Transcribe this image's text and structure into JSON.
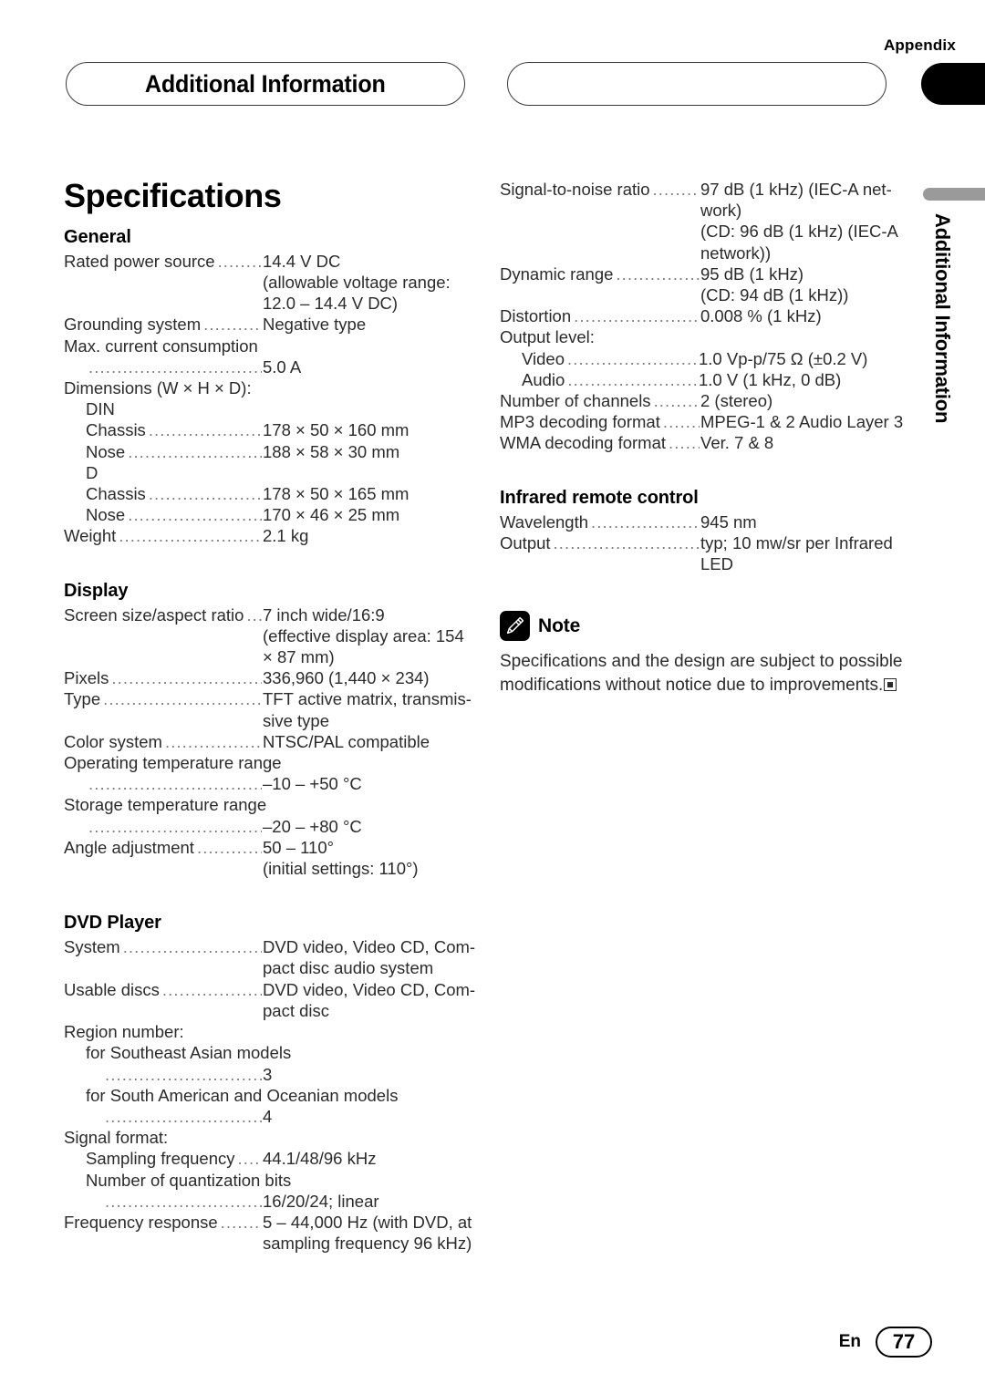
{
  "header": {
    "appendix_label": "Appendix",
    "chapter_title": "Additional Information",
    "empty_pill": ""
  },
  "side_tab": {
    "label": "Additional Information"
  },
  "page_title": "Specifications",
  "footer": {
    "language": "En",
    "page_number": "77"
  },
  "leader": "..................................................................................................",
  "sections": {
    "general": {
      "heading": "General",
      "rows": [
        {
          "label": "Rated power source",
          "value": "14.4 V DC"
        },
        {
          "cont": "(allowable voltage range:"
        },
        {
          "cont": "12.0 – 14.4 V DC)"
        },
        {
          "label": "Grounding system",
          "value": "Negative type"
        },
        {
          "line": "Max. current consumption"
        },
        {
          "label": "",
          "value": "5.0 A",
          "indent": 1
        },
        {
          "line": "Dimensions (W × H × D):"
        },
        {
          "line": "DIN",
          "indent": 1
        },
        {
          "label": "Chassis",
          "value": "178 × 50 × 160 mm",
          "indent": 1
        },
        {
          "label": "Nose",
          "value": "188 × 58 × 30 mm",
          "indent": 1
        },
        {
          "line": "D",
          "indent": 1
        },
        {
          "label": "Chassis",
          "value": "178 × 50 × 165 mm",
          "indent": 1
        },
        {
          "label": "Nose",
          "value": "170 × 46 × 25 mm",
          "indent": 1
        },
        {
          "label": "Weight",
          "value": "2.1 kg"
        }
      ]
    },
    "display": {
      "heading": "Display",
      "rows": [
        {
          "label": "Screen size/aspect ratio",
          "value": "7 inch wide/16:9"
        },
        {
          "cont": "(effective display area: 154"
        },
        {
          "cont": "× 87 mm)"
        },
        {
          "label": "Pixels",
          "value": "336,960 (1,440 × 234)"
        },
        {
          "label": "Type",
          "value": "TFT active matrix, transmis-"
        },
        {
          "cont": "sive type"
        },
        {
          "label": "Color system",
          "value": "NTSC/PAL compatible"
        },
        {
          "line": "Operating temperature range"
        },
        {
          "label": "",
          "value": "–10 – +50 °C",
          "indent": 1
        },
        {
          "line": "Storage temperature range"
        },
        {
          "label": "",
          "value": "–20 – +80 °C",
          "indent": 1
        },
        {
          "label": "Angle adjustment",
          "value": "50 – 110°"
        },
        {
          "cont": "(initial settings: 110°)"
        }
      ]
    },
    "dvd_player": {
      "heading": "DVD Player",
      "rows": [
        {
          "label": "System",
          "value": "DVD video, Video CD, Com-"
        },
        {
          "cont": "pact disc audio system"
        },
        {
          "label": "Usable discs",
          "value": "DVD video, Video CD, Com-"
        },
        {
          "cont": "pact disc"
        },
        {
          "line": "Region number:"
        },
        {
          "line": "for Southeast Asian models",
          "indent": 1
        },
        {
          "label": "",
          "value": "3",
          "indent": 2
        },
        {
          "line": "for South American and Oceanian models",
          "indent": 1
        },
        {
          "label": "",
          "value": "4",
          "indent": 2
        },
        {
          "line": "Signal format:"
        },
        {
          "label": "Sampling frequency",
          "value": "44.1/48/96 kHz",
          "indent": 1
        },
        {
          "line": "Number of quantization bits",
          "indent": 1
        },
        {
          "label": "",
          "value": "16/20/24; linear",
          "indent": 2
        },
        {
          "label": "Frequency response",
          "value": "5 – 44,000 Hz (with DVD, at"
        },
        {
          "cont": "sampling frequency 96 kHz)"
        }
      ]
    },
    "audio": {
      "rows": [
        {
          "label": "Signal-to-noise ratio",
          "value": "97 dB (1 kHz) (IEC-A net-"
        },
        {
          "cont": "work)"
        },
        {
          "cont": "(CD: 96 dB (1 kHz) (IEC-A"
        },
        {
          "cont": "network))"
        },
        {
          "label": "Dynamic range",
          "value": "95 dB (1 kHz)"
        },
        {
          "cont": "(CD: 94 dB (1 kHz))"
        },
        {
          "label": "Distortion",
          "value": "0.008 % (1 kHz)"
        },
        {
          "line": "Output level:"
        },
        {
          "label": "Video",
          "value": "1.0 Vp-p/75 Ω (±0.2 V)",
          "indent": 1
        },
        {
          "label": "Audio",
          "value": "1.0 V (1 kHz, 0 dB)",
          "indent": 1
        },
        {
          "label": "Number of channels",
          "value": "2 (stereo)"
        },
        {
          "label": "MP3 decoding format",
          "value": "MPEG-1 & 2 Audio Layer 3"
        },
        {
          "label": "WMA decoding format",
          "value": "Ver. 7 & 8"
        }
      ]
    },
    "infrared": {
      "heading": "Infrared remote control",
      "rows": [
        {
          "label": "Wavelength",
          "value": "945 nm"
        },
        {
          "label": "Output",
          "value": "typ; 10 mw/sr per Infrared"
        },
        {
          "cont": "LED"
        }
      ]
    }
  },
  "note": {
    "title": "Note",
    "icon": "pencil-icon",
    "body": "Specifications and the design are subject to possible modifications without notice due to improvements."
  }
}
